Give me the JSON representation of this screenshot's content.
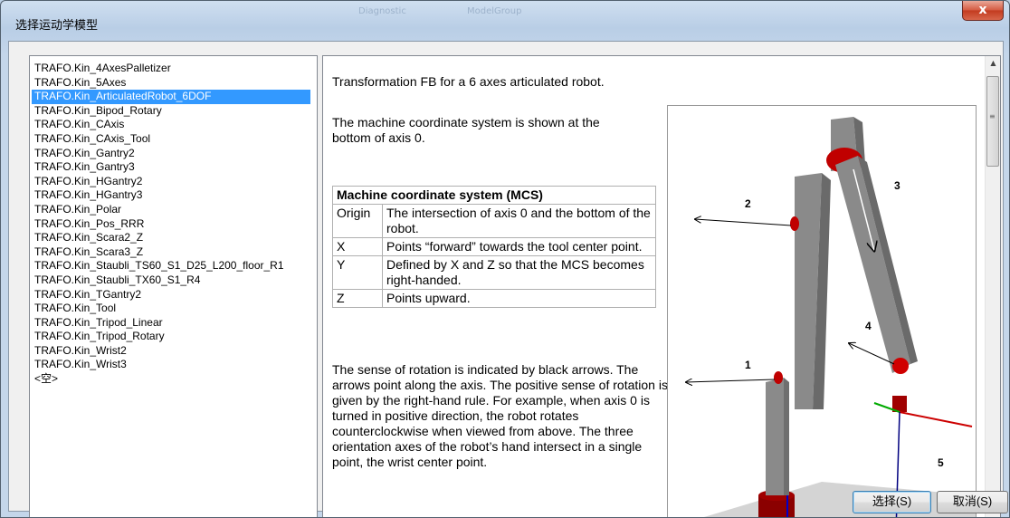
{
  "window": {
    "title": "选择运动学模型",
    "close_glyph": "x",
    "ghost_labels": [
      "Diagnostic",
      "ModelGroup"
    ]
  },
  "list": {
    "items": [
      "TRAFO.Kin_4AxesPalletizer",
      "TRAFO.Kin_5Axes",
      "TRAFO.Kin_ArticulatedRobot_6DOF",
      "TRAFO.Kin_Bipod_Rotary",
      "TRAFO.Kin_CAxis",
      "TRAFO.Kin_CAxis_Tool",
      "TRAFO.Kin_Gantry2",
      "TRAFO.Kin_Gantry3",
      "TRAFO.Kin_HGantry2",
      "TRAFO.Kin_HGantry3",
      "TRAFO.Kin_Polar",
      "TRAFO.Kin_Pos_RRR",
      "TRAFO.Kin_Scara2_Z",
      "TRAFO.Kin_Scara3_Z",
      "TRAFO.Kin_Staubli_TS60_S1_D25_L200_floor_R1",
      "TRAFO.Kin_Staubli_TX60_S1_R4",
      "TRAFO.Kin_TGantry2",
      "TRAFO.Kin_Tool",
      "TRAFO.Kin_Tripod_Linear",
      "TRAFO.Kin_Tripod_Rotary",
      "TRAFO.Kin_Wrist2",
      "TRAFO.Kin_Wrist3",
      "<空>"
    ],
    "selected_index": 2
  },
  "doc": {
    "intro": "Transformation FB for a 6 axes articulated robot.",
    "mcs_text": "The machine coordinate system is shown at the bottom of axis 0.",
    "table": {
      "header": "Machine coordinate system (MCS)",
      "rows": [
        {
          "key": "Origin",
          "value": "The intersection of axis 0 and the bottom of the robot."
        },
        {
          "key": "X",
          "value": "Points “forward” towards the tool center point."
        },
        {
          "key": "Y",
          "value": "Defined by X and Z so that the MCS becomes right-handed."
        },
        {
          "key": "Z",
          "value": "Points upward."
        }
      ]
    },
    "rotation_text": "The sense of rotation is indicated by black arrows. The arrows point along the axis. The positive sense of rotation is given by the right-hand rule. For example, when axis 0 is turned in positive direction, the robot rotates counterclockwise when viewed from above. The three orientation axes of the robot’s hand intersect in a single point, the wrist center point.",
    "figure_labels": {
      "axis1": "1",
      "axis2": "2",
      "axis3": "3",
      "axis4": "4",
      "axis5": "5"
    }
  },
  "buttons": {
    "ok": "选择(S)",
    "cancel": "取消(S)"
  },
  "colors": {
    "selection": "#3399ff",
    "robot_gray": "#8a8a8a",
    "joint_red": "#c00000"
  }
}
